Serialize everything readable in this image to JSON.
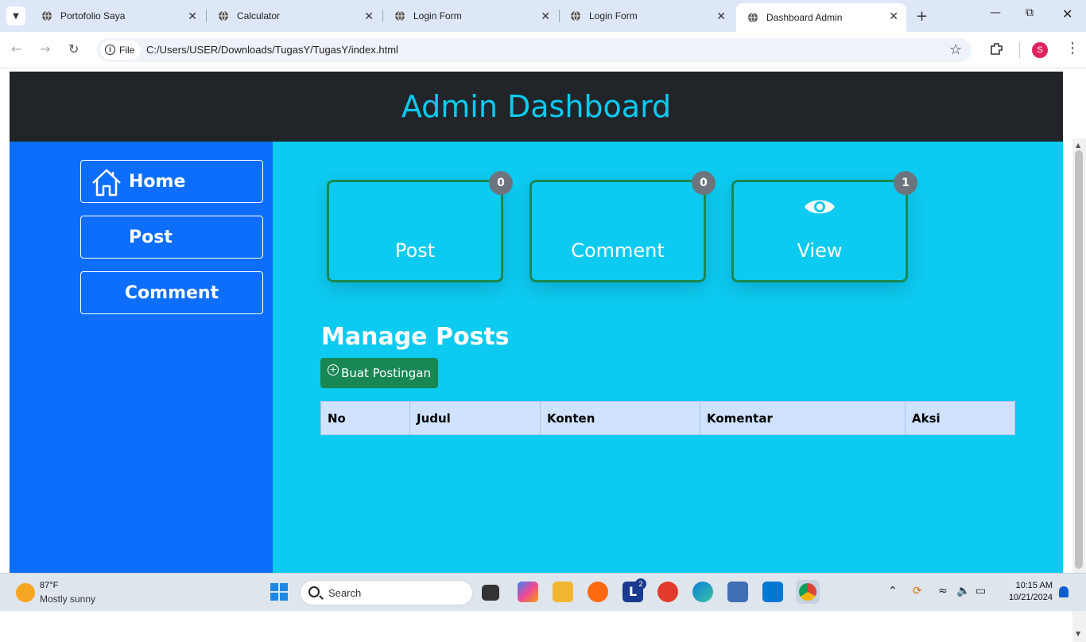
{
  "browser": {
    "tabs": [
      {
        "title": "Portofolio Saya"
      },
      {
        "title": "Calculator"
      },
      {
        "title": "Login Form"
      },
      {
        "title": "Login Form"
      },
      {
        "title": "Dashboard Admin",
        "active": true
      }
    ],
    "chip_label": "File",
    "url": "C:/Users/USER/Downloads/TugasY/TugasY/index.html",
    "profile_initial": "S"
  },
  "page": {
    "header_title": "Admin Dashboard",
    "sidebar": {
      "items": [
        {
          "label": "Home",
          "icon": "home-icon"
        },
        {
          "label": "Post"
        },
        {
          "label": "Comment"
        }
      ]
    },
    "cards": [
      {
        "title": "Post",
        "badge": "0"
      },
      {
        "title": "Comment",
        "badge": "0"
      },
      {
        "title": "View",
        "badge": "1",
        "icon": "eye-icon"
      }
    ],
    "section_title": "Manage Posts",
    "create_button": "Buat Postingan",
    "table": {
      "columns": [
        "No",
        "Judul",
        "Konten",
        "Komentar",
        "Aksi"
      ]
    },
    "colors": {
      "header_bg": "#212529",
      "header_text": "#0dcaf0",
      "sidebar_bg": "#0d6efd",
      "main_bg": "#0dcaf0",
      "card_border": "#198754",
      "button_bg": "#198754",
      "table_header_bg": "#cfe2ff"
    }
  },
  "taskbar": {
    "weather_temp": "87°F",
    "weather_desc": "Mostly sunny",
    "search_label": "Search",
    "time": "10:15 AM",
    "date": "10/21/2024",
    "badge_count": "2"
  }
}
